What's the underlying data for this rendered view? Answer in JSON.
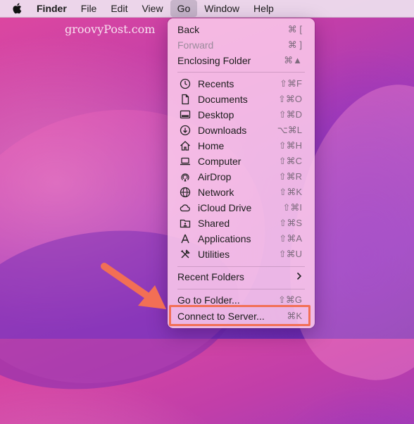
{
  "menubar": {
    "apple_icon": "apple-logo-icon",
    "items": [
      "Finder",
      "File",
      "Edit",
      "View",
      "Go",
      "Window",
      "Help"
    ]
  },
  "watermark": "groovyPost.com",
  "go_menu": {
    "nav": [
      {
        "label": "Back",
        "shortcut": "⌘ ["
      },
      {
        "label": "Forward",
        "shortcut": "⌘ ]",
        "disabled": true
      },
      {
        "label": "Enclosing Folder",
        "shortcut": "⌘▲"
      }
    ],
    "places": [
      {
        "label": "Recents",
        "shortcut": "⇧⌘F",
        "icon": "clock-icon"
      },
      {
        "label": "Documents",
        "shortcut": "⇧⌘O",
        "icon": "document-icon"
      },
      {
        "label": "Desktop",
        "shortcut": "⇧⌘D",
        "icon": "desktop-icon"
      },
      {
        "label": "Downloads",
        "shortcut": "⌥⌘L",
        "icon": "download-icon"
      },
      {
        "label": "Home",
        "shortcut": "⇧⌘H",
        "icon": "home-icon"
      },
      {
        "label": "Computer",
        "shortcut": "⇧⌘C",
        "icon": "laptop-icon"
      },
      {
        "label": "AirDrop",
        "shortcut": "⇧⌘R",
        "icon": "airdrop-icon"
      },
      {
        "label": "Network",
        "shortcut": "⇧⌘K",
        "icon": "globe-icon"
      },
      {
        "label": "iCloud Drive",
        "shortcut": "⇧⌘I",
        "icon": "cloud-icon"
      },
      {
        "label": "Shared",
        "shortcut": "⇧⌘S",
        "icon": "shared-folder-icon"
      },
      {
        "label": "Applications",
        "shortcut": "⇧⌘A",
        "icon": "applications-icon"
      },
      {
        "label": "Utilities",
        "shortcut": "⇧⌘U",
        "icon": "utilities-icon"
      }
    ],
    "recent_folders": {
      "label": "Recent Folders",
      "icon": "chevron-right-icon"
    },
    "go_to_folder": {
      "label": "Go to Folder...",
      "shortcut": "⇧⌘G"
    },
    "connect_to_server": {
      "label": "Connect to Server...",
      "shortcut": "⌘K"
    }
  },
  "colors": {
    "highlight": "#f26f55",
    "arrow": "#f26f55"
  }
}
